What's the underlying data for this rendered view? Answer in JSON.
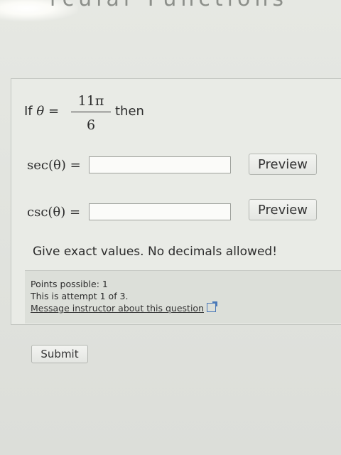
{
  "header": {
    "title_fragment": "rcular Functions"
  },
  "question": {
    "intro_if": "If",
    "theta_symbol": "θ",
    "equals": "=",
    "frac_numerator": "11π",
    "frac_denominator": "6",
    "then": "then",
    "sec_label": "sec(θ) =",
    "csc_label": "csc(θ) =",
    "sec_value": "",
    "csc_value": "",
    "preview_label": "Preview",
    "instruction": "Give exact values. No decimals allowed!"
  },
  "info": {
    "points": "Points possible: 1",
    "attempt": "This is attempt 1 of 3.",
    "message_link": "Message instructor about this question"
  },
  "actions": {
    "submit_label": "Submit"
  }
}
